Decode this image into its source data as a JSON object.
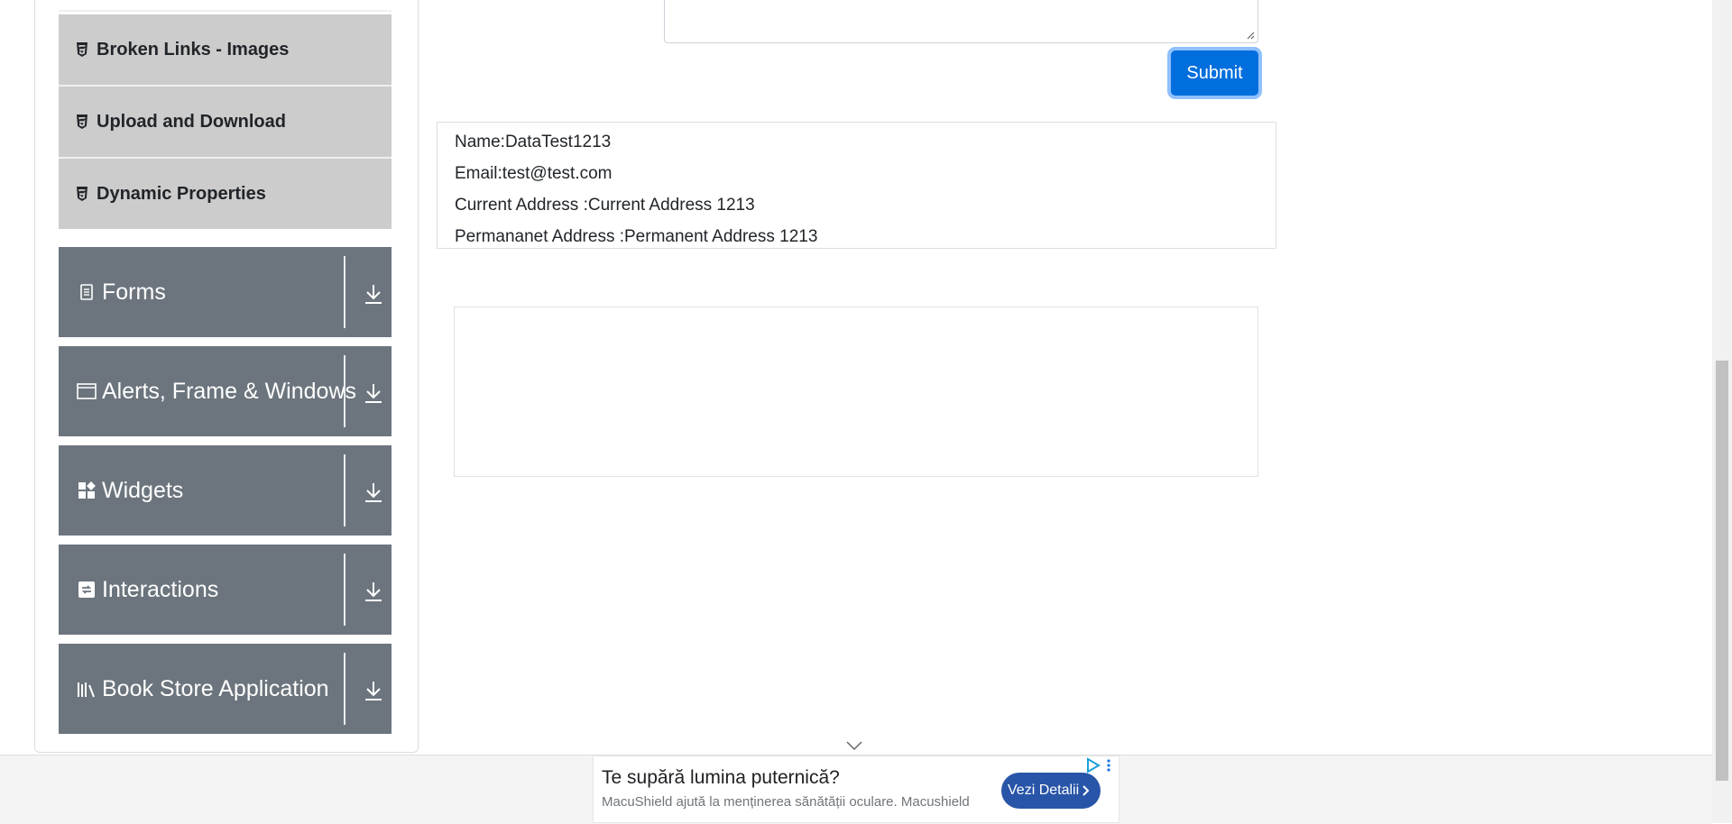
{
  "sidebar": {
    "elements_items": [
      {
        "label": "Broken Links - Images",
        "icon": "html5-icon"
      },
      {
        "label": "Upload and Download",
        "icon": "html5-icon"
      },
      {
        "label": "Dynamic Properties",
        "icon": "html5-icon"
      }
    ],
    "groups": [
      {
        "label": "Forms",
        "icon": "document-icon"
      },
      {
        "label": "Alerts, Frame & Windows",
        "icon": "window-icon"
      },
      {
        "label": "Widgets",
        "icon": "widgets-icon"
      },
      {
        "label": "Interactions",
        "icon": "interactions-icon"
      },
      {
        "label": "Book Store Application",
        "icon": "books-icon"
      }
    ]
  },
  "form": {
    "permanent_address_value": "",
    "submit_label": "Submit"
  },
  "output": {
    "name": "Name:DataTest1213",
    "email": "Email:test@test.com",
    "current_address": "Current Address :Current Address 1213",
    "permanent_address": "Permananet Address :Permanent Address 1213"
  },
  "ad": {
    "title": "Te supără lumina puternică?",
    "description": "MacuShield ajută la menținerea sănătății oculare. Macushield",
    "button_label": "Vezi Detalii"
  },
  "colors": {
    "group_bg": "#6c757d",
    "item_bg": "#cccccc",
    "submit_bg": "#006edc",
    "ad_button_bg": "#2855a7"
  }
}
